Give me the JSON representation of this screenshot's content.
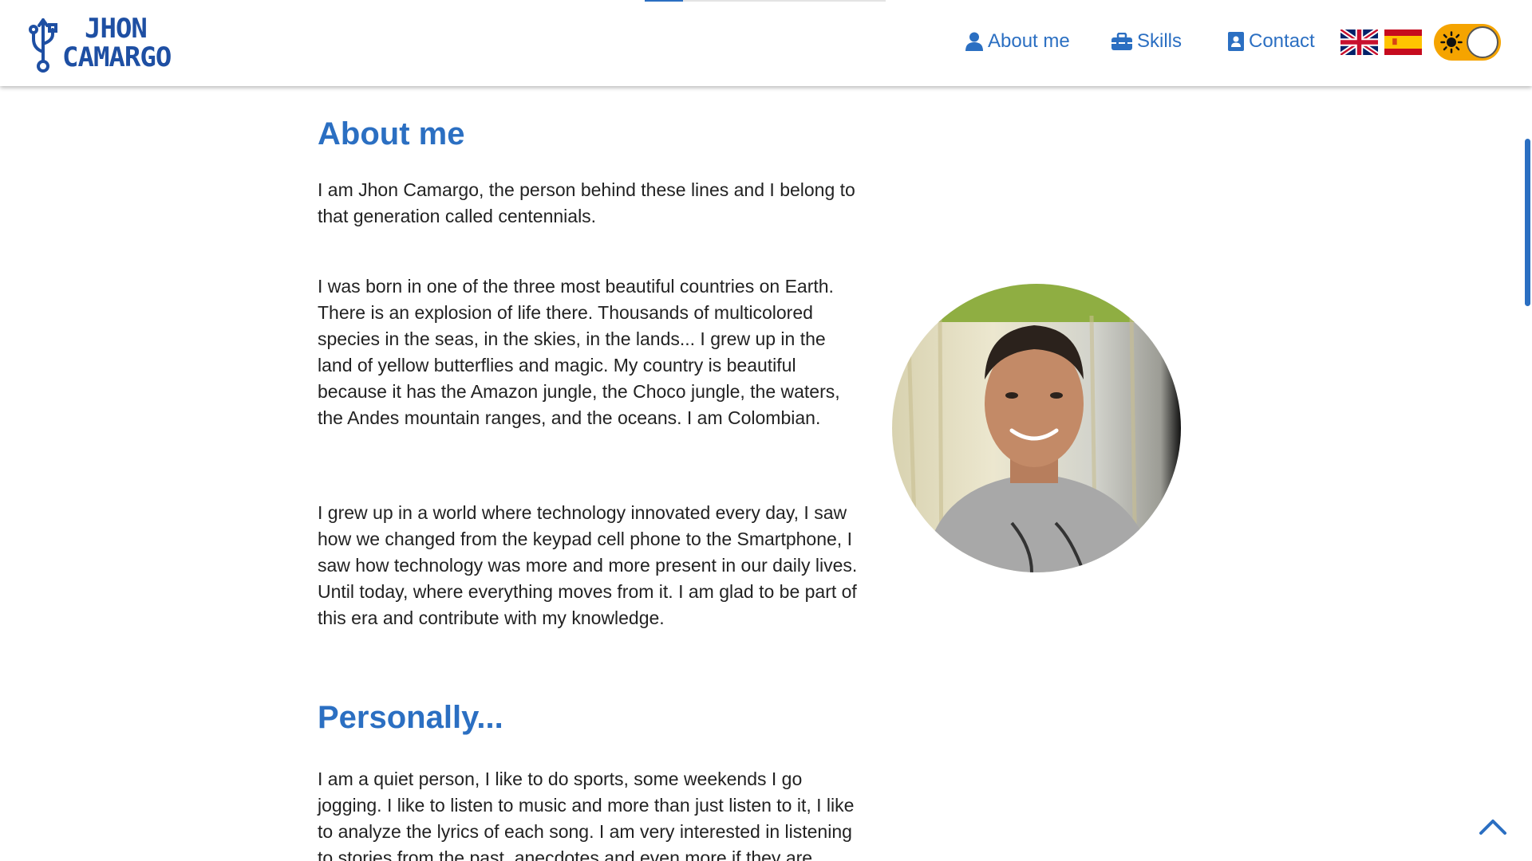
{
  "header": {
    "logo": {
      "line1": "JHON",
      "line2": "CAMARGO"
    },
    "scroll_progress": 0.16,
    "nav": [
      {
        "label": "About me",
        "icon": "user-icon"
      },
      {
        "label": "Skills",
        "icon": "toolbox-icon"
      },
      {
        "label": "Contact",
        "icon": "contact-card-icon"
      }
    ],
    "languages": [
      {
        "icon": "uk-flag-icon"
      },
      {
        "icon": "spain-flag-icon"
      }
    ],
    "theme_toggle": {
      "icon": "sun-icon",
      "state": "light"
    }
  },
  "main": {
    "about_title": "About me",
    "paragraphs": [
      "I am Jhon Camargo, the person behind these lines and I belong to that generation called centennials.",
      "I was born in one of the three most beautiful countries on Earth. There is an explosion of life there. Thousands of multicolored species in the seas, in the skies, in the lands... I grew up in the land of yellow butterflies and magic. My country is beautiful because it has the Amazon jungle, the Choco jungle, the waters, the Andes mountain ranges, and the oceans. I am Colombian.",
      "I grew up in a world where technology innovated every day, I saw how we changed from the keypad cell phone to the Smartphone, I saw how technology was more and more present in our daily lives. Until today, where everything moves from it. I am glad to be part of this era and contribute with my knowledge."
    ],
    "personally_title": "Personally...",
    "personally_text": "I am a quiet person, I like to do sports, some weekends I go jogging. I like to listen to music and more than just listen to it, I like to analyze the lyrics of each song. I am very interested in listening to stories from the past, anecdotes and even more if they are taken to movies or series."
  },
  "colors": {
    "accent": "#2b6fc2",
    "logo": "#1e4fa3",
    "toggle": "#f5a400"
  },
  "icons": {
    "back_to_top": "chevron-up-icon"
  }
}
